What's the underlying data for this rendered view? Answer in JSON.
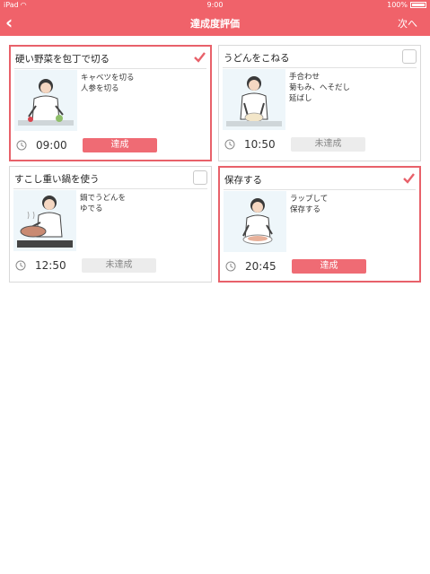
{
  "status_bar": {
    "carrier": "iPad",
    "time": "9:00",
    "battery": "100%"
  },
  "nav": {
    "back_icon": "chevron-left-icon",
    "title": "達成度評価",
    "next_label": "次へ"
  },
  "colors": {
    "accent": "#f0626a",
    "achieved": "#ef6b74",
    "not_achieved": "#ececec"
  },
  "cards": [
    {
      "title": "硬い野菜を包丁で切る",
      "checked": true,
      "steps": [
        "キャベツを切る",
        "人参を切る"
      ],
      "time": "09:00",
      "status": "達成"
    },
    {
      "title": "うどんをこねる",
      "checked": false,
      "steps": [
        "手合わせ",
        "菊もみ、へそだし",
        "延ばし"
      ],
      "time": "10:50",
      "status": "未達成"
    },
    {
      "title": "すこし重い鍋を使う",
      "checked": false,
      "steps": [
        "鍋でうどんを",
        "ゆでる"
      ],
      "time": "12:50",
      "status": "未達成"
    },
    {
      "title": "保存する",
      "checked": true,
      "steps": [
        "ラップして",
        "保存する"
      ],
      "time": "20:45",
      "status": "達成"
    }
  ]
}
